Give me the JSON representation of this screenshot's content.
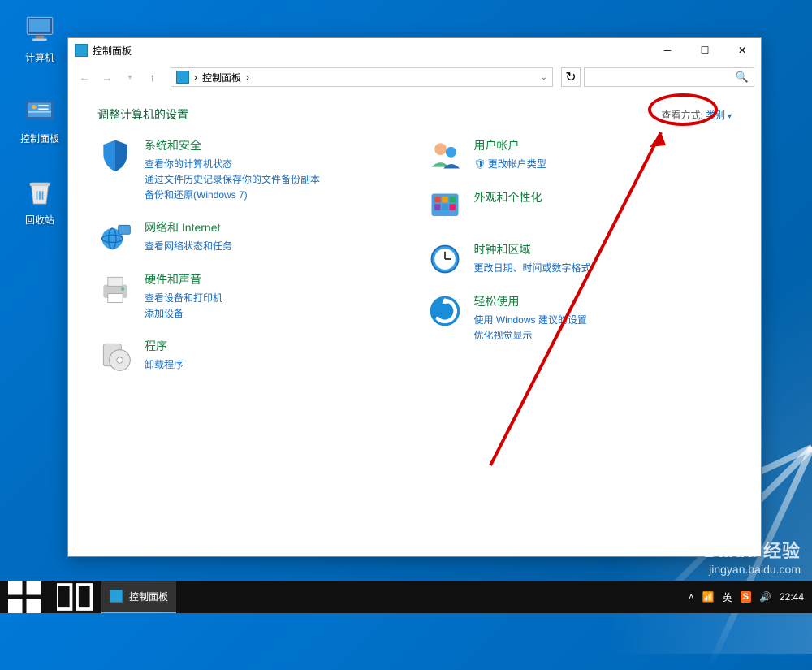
{
  "desktop": {
    "icons": [
      {
        "label": "计算机"
      },
      {
        "label": "控制面板"
      },
      {
        "label": "回收站"
      }
    ]
  },
  "window": {
    "title": "控制面板",
    "breadcrumb": "控制面板",
    "breadcrumb_sep": "›",
    "page_title": "调整计算机的设置",
    "view_by_label": "查看方式:",
    "view_by_value": "类别",
    "categories": {
      "system_security": {
        "title": "系统和安全",
        "links": [
          "查看你的计算机状态",
          "通过文件历史记录保存你的文件备份副本",
          "备份和还原(Windows 7)"
        ]
      },
      "network": {
        "title": "网络和 Internet",
        "links": [
          "查看网络状态和任务"
        ]
      },
      "hardware": {
        "title": "硬件和声音",
        "links": [
          "查看设备和打印机",
          "添加设备"
        ]
      },
      "programs": {
        "title": "程序",
        "links": [
          "卸载程序"
        ]
      },
      "accounts": {
        "title": "用户帐户",
        "links": [
          "更改帐户类型"
        ],
        "shield": true
      },
      "appearance": {
        "title": "外观和个性化",
        "links": []
      },
      "clock": {
        "title": "时钟和区域",
        "links": [
          "更改日期、时间或数字格式"
        ]
      },
      "ease": {
        "title": "轻松使用",
        "links": [
          "使用 Windows 建议的设置",
          "优化视觉显示"
        ]
      }
    }
  },
  "taskbar": {
    "active_app": "控制面板",
    "ime_lang": "英",
    "clock": "22:44"
  },
  "watermark": {
    "brand": "Baidu 经验",
    "url": "jingyan.baidu.com"
  }
}
